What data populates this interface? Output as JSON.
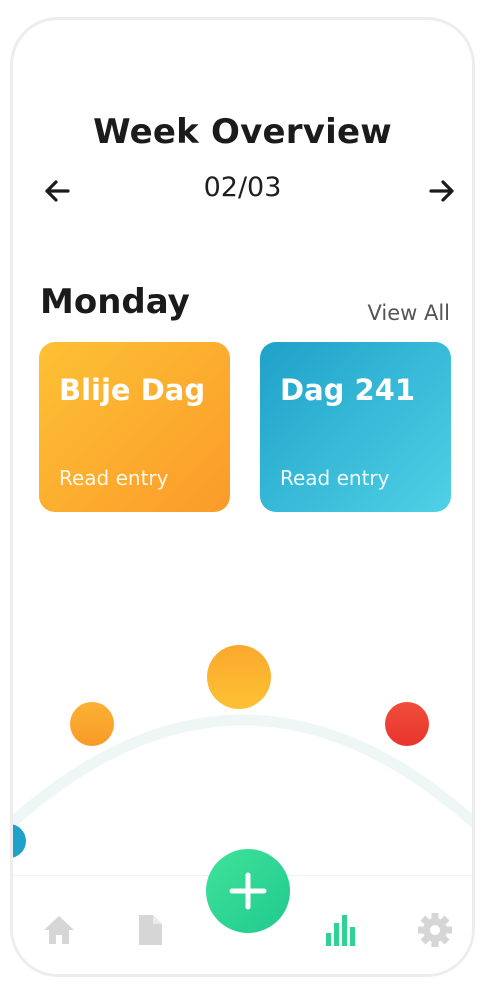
{
  "header": {
    "title": "Week Overview",
    "date": "02/03",
    "prev_icon": "arrow-left-icon",
    "next_icon": "arrow-right-icon"
  },
  "day": {
    "name": "Monday",
    "view_all_label": "View All",
    "entries": [
      {
        "title": "Blije Dag",
        "link_label": "Read entry",
        "color_from": "#fdc134",
        "color_to": "#fb9b2a"
      },
      {
        "title": "Dag 241",
        "link_label": "Read entry",
        "color_from": "#1fa1c9",
        "color_to": "#4fd1e6"
      }
    ]
  },
  "mood_chart": {
    "track_color": "#eef6f6",
    "moods": [
      {
        "icon": "mood-dot-blue",
        "color": "#1fa1c9"
      },
      {
        "icon": "mood-dot-orange",
        "color": "#fbb236"
      },
      {
        "icon": "mood-dot-yellow",
        "color": "#fdb72e"
      },
      {
        "icon": "mood-dot-red",
        "color": "#f0483a"
      }
    ]
  },
  "tabbar": {
    "tabs": [
      {
        "icon": "home-icon",
        "active": false
      },
      {
        "icon": "document-icon",
        "active": false
      },
      {
        "icon": "add-icon",
        "active": false
      },
      {
        "icon": "bar-chart-icon",
        "active": true
      },
      {
        "icon": "gear-icon",
        "active": false
      }
    ],
    "active_color": "#2ed392",
    "inactive_color": "#d6d6d6"
  }
}
